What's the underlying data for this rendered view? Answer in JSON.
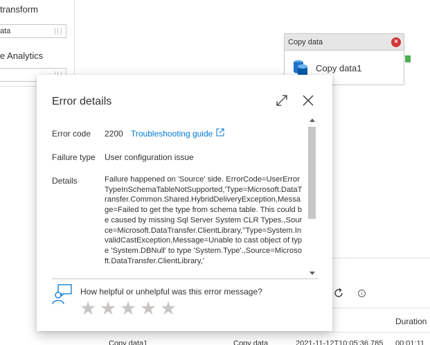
{
  "sidebar": {
    "heading1": "transform",
    "input1": "ata",
    "heading2": "e Analytics"
  },
  "activity": {
    "type_label": "Copy data",
    "name": "Copy data1",
    "error_badge": "×"
  },
  "output": {
    "duration_header": "Duration",
    "row": {
      "name": "Copy data1",
      "type": "Copy data",
      "run_start": "2021-11-12T10:05:36.785",
      "duration": "00:01:11"
    }
  },
  "dialog": {
    "title": "Error details",
    "error_code_label": "Error code",
    "error_code": "2200",
    "troubleshooting_link": "Troubleshooting guide",
    "failure_type_label": "Failure type",
    "failure_type": "User configuration issue",
    "details_label": "Details",
    "details": "Failure happened on 'Source' side. ErrorCode=UserErrorTypeInSchemaTableNotSupported,'Type=Microsoft.DataTransfer.Common.Shared.HybridDeliveryException,Message=Failed to get the type from schema table. This could be caused by missing Sql Server System CLR Types.,Source=Microsoft.DataTransfer.ClientLibrary,''Type=System.InvalidCastException,Message=Unable to cast object of type 'System.DBNull' to type 'System.Type'.,Source=Microsoft.DataTransfer.ClientLibrary,'",
    "feedback_question": "How helpful or unhelpful was this error message?",
    "rating": 0,
    "stars": [
      "★",
      "★",
      "★",
      "★",
      "★"
    ]
  },
  "colors": {
    "accent": "#0078d4",
    "error": "#d13438",
    "port": "#4caf50",
    "star": "#c8c6c4"
  }
}
